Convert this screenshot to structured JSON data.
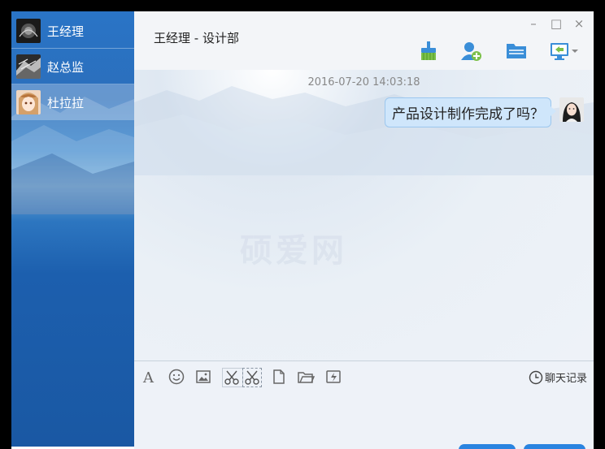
{
  "contacts": [
    {
      "name": "王经理",
      "active": false
    },
    {
      "name": "赵总监",
      "active": false
    },
    {
      "name": "杜拉拉",
      "active": true
    }
  ],
  "chat": {
    "title": "王经理 - 设计部",
    "window_controls": {
      "minimize": "–",
      "maximize": "□",
      "close": "×"
    },
    "toolbar_icons": [
      "clean-screen-icon",
      "add-contact-icon",
      "file-transfer-icon",
      "remote-desktop-icon"
    ],
    "timestamp": "2016-07-20 14:03:18",
    "messages": [
      {
        "text": "产品设计制作完成了吗？",
        "from": "me"
      }
    ],
    "watermark": "硕爱网"
  },
  "input_toolbar": {
    "tools": [
      "font-icon",
      "emoji-icon",
      "image-icon",
      "screenshot-icon",
      "screenshot-hide-icon",
      "file-icon",
      "folder-icon",
      "shake-icon"
    ],
    "history_label": "聊天记录"
  },
  "colors": {
    "accent": "#2a84e0",
    "bubble": "#cfe6fb",
    "sidebar": "#1f66b4"
  }
}
